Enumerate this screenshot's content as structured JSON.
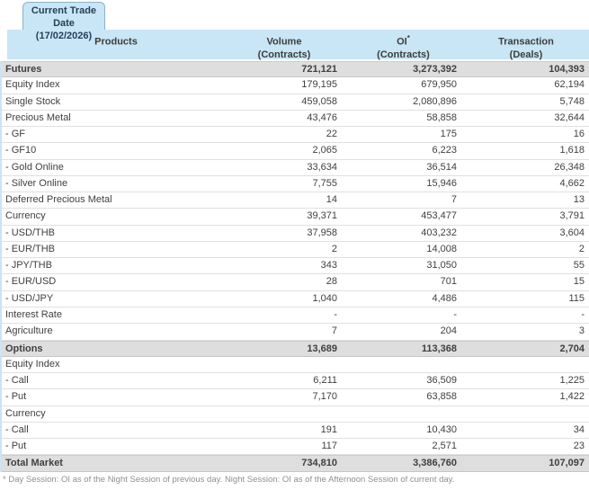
{
  "tab": {
    "title_line1": "Current Trade Date",
    "title_line2": "(17/02/2026)"
  },
  "columns": [
    {
      "label": "Products",
      "sup": "",
      "sublabel": ""
    },
    {
      "label": "Volume",
      "sup": "",
      "sublabel": "(Contracts)"
    },
    {
      "label": "OI",
      "sup": "*",
      "sublabel": "(Contracts)"
    },
    {
      "label": "Transaction",
      "sup": "",
      "sublabel": "(Deals)"
    }
  ],
  "rows": [
    {
      "label": "Futures",
      "volume": "721,121",
      "oi": "3,273,392",
      "deals": "104,393",
      "section": true
    },
    {
      "label": "Equity Index",
      "volume": "179,195",
      "oi": "679,950",
      "deals": "62,194",
      "section": false
    },
    {
      "label": "Single Stock",
      "volume": "459,058",
      "oi": "2,080,896",
      "deals": "5,748",
      "section": false
    },
    {
      "label": "Precious Metal",
      "volume": "43,476",
      "oi": "58,858",
      "deals": "32,644",
      "section": false
    },
    {
      "label": "- GF",
      "volume": "22",
      "oi": "175",
      "deals": "16",
      "section": false
    },
    {
      "label": "- GF10",
      "volume": "2,065",
      "oi": "6,223",
      "deals": "1,618",
      "section": false
    },
    {
      "label": "- Gold Online",
      "volume": "33,634",
      "oi": "36,514",
      "deals": "26,348",
      "section": false
    },
    {
      "label": "- Silver Online",
      "volume": "7,755",
      "oi": "15,946",
      "deals": "4,662",
      "section": false
    },
    {
      "label": "Deferred Precious Metal",
      "volume": "14",
      "oi": "7",
      "deals": "13",
      "section": false
    },
    {
      "label": "Currency",
      "volume": "39,371",
      "oi": "453,477",
      "deals": "3,791",
      "section": false
    },
    {
      "label": "- USD/THB",
      "volume": "37,958",
      "oi": "403,232",
      "deals": "3,604",
      "section": false
    },
    {
      "label": "- EUR/THB",
      "volume": "2",
      "oi": "14,008",
      "deals": "2",
      "section": false
    },
    {
      "label": "- JPY/THB",
      "volume": "343",
      "oi": "31,050",
      "deals": "55",
      "section": false
    },
    {
      "label": "- EUR/USD",
      "volume": "28",
      "oi": "701",
      "deals": "15",
      "section": false
    },
    {
      "label": "- USD/JPY",
      "volume": "1,040",
      "oi": "4,486",
      "deals": "115",
      "section": false
    },
    {
      "label": "Interest Rate",
      "volume": "-",
      "oi": "-",
      "deals": "-",
      "section": false
    },
    {
      "label": "Agriculture",
      "volume": "7",
      "oi": "204",
      "deals": "3",
      "section": false
    },
    {
      "label": "Options",
      "volume": "13,689",
      "oi": "113,368",
      "deals": "2,704",
      "section": true
    },
    {
      "label": "Equity Index",
      "volume": "",
      "oi": "",
      "deals": "",
      "section": false
    },
    {
      "label": "- Call",
      "volume": "6,211",
      "oi": "36,509",
      "deals": "1,225",
      "section": false
    },
    {
      "label": "- Put",
      "volume": "7,170",
      "oi": "63,858",
      "deals": "1,422",
      "section": false
    },
    {
      "label": "Currency",
      "volume": "",
      "oi": "",
      "deals": "",
      "section": false
    },
    {
      "label": "- Call",
      "volume": "191",
      "oi": "10,430",
      "deals": "34",
      "section": false
    },
    {
      "label": "- Put",
      "volume": "117",
      "oi": "2,571",
      "deals": "23",
      "section": false
    },
    {
      "label": "Total Market",
      "volume": "734,810",
      "oi": "3,386,760",
      "deals": "107,097",
      "section": true
    }
  ],
  "footnote": "* Day Session: OI as of the Night Session of previous day. Night Session: OI as of the Afternoon Session of current day.",
  "colors": {
    "header_bg": "#c8e6f5",
    "section_row_bg": "#dedede",
    "tab_border": "#8ab1c9",
    "text": "#3f3f3f",
    "footnote_text": "#8f8f8f"
  }
}
